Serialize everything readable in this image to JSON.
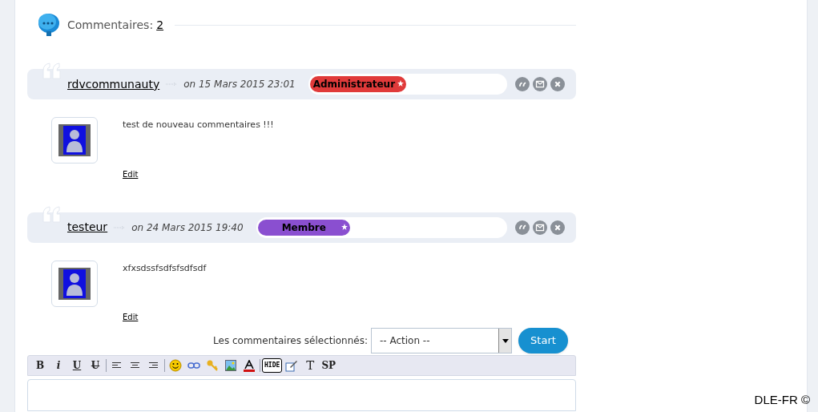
{
  "header": {
    "label": "Commentaires:",
    "count": "2"
  },
  "comments": [
    {
      "author": "rdvcommunauty",
      "date": "on 15 Mars 2015 23:01",
      "group": "Administrateur",
      "color": "#e03a3a",
      "text": "test de nouveau commentaires !!!",
      "edit": "Edit"
    },
    {
      "author": "testeur",
      "date": "on 24 Mars 2015 19:40",
      "group": "Membre",
      "color": "#8a4fd0",
      "text": "xfxsdssfsdfsfsdfsdf",
      "edit": "Edit"
    }
  ],
  "mass_action": {
    "label": "Les commentaires sélectionnés:",
    "value": "-- Action --",
    "button": "Start"
  },
  "toolbar_text": [
    "B",
    "i",
    "U",
    "U",
    "HIDE",
    "T",
    "SP"
  ],
  "footer": "DLE-FR ©"
}
